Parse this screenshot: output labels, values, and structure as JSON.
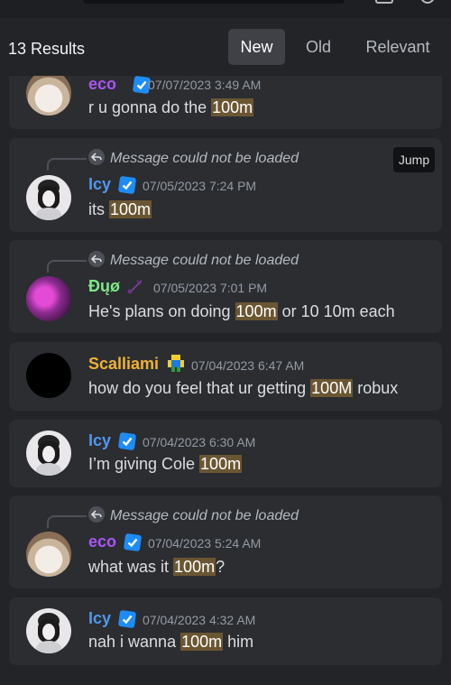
{
  "header": {
    "results": "13 Results",
    "tabs": [
      {
        "label": "New",
        "active": true
      },
      {
        "label": "Old",
        "active": false
      },
      {
        "label": "Relevant",
        "active": false
      }
    ]
  },
  "colors": {
    "eco": "#a855f7",
    "icy": "#5197ed",
    "duo": "#7ee787",
    "scalliami": "#f0b232",
    "highlight": "#6b5632",
    "verified": "#1d8cf8"
  },
  "messages": [
    {
      "user": "eco",
      "time": "07/07/2023 3:49 AM",
      "pre": "r u gonna do the ",
      "hl": "100m",
      "post": ""
    },
    {
      "reply": "Message could not be loaded",
      "jump": "Jump",
      "user": "Icy",
      "time": "07/05/2023 7:24 PM",
      "pre": "its ",
      "hl": "100m",
      "post": ""
    },
    {
      "reply": "Message could not be loaded",
      "user": "Đųø",
      "time": "07/05/2023 7:01 PM",
      "pre": "He's plans on doing ",
      "hl": "100m",
      "post": " or 10 10m each"
    },
    {
      "user": "Scalliami",
      "time": "07/04/2023 6:47 AM",
      "pre": "how do you feel that ur getting ",
      "hl": "100M",
      "post": " robux"
    },
    {
      "user": "Icy",
      "time": "07/04/2023 6:30 AM",
      "pre": "I’m giving Cole ",
      "hl": "100m",
      "post": ""
    },
    {
      "reply": "Message could not be loaded",
      "user": "eco",
      "time": "07/04/2023 5:24 AM",
      "pre": "what was it ",
      "hl": "100m",
      "post": "?"
    },
    {
      "user": "Icy",
      "time": "07/04/2023 4:32 AM",
      "pre": "nah i wanna ",
      "hl": "100m",
      "post": " him"
    }
  ]
}
